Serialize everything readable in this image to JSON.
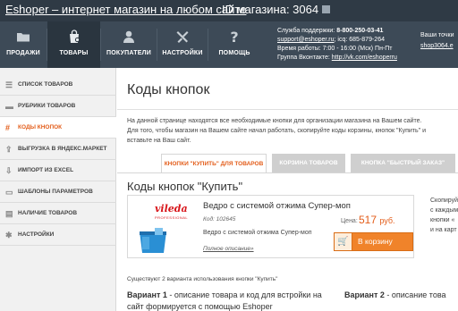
{
  "header": {
    "brand": "Eshoper – интернет магазин на любом сайте",
    "shop_id": "ID магазина: 3064"
  },
  "nav": {
    "items": [
      {
        "label": "ПРОДАЖИ",
        "icon": "folder-icon"
      },
      {
        "label": "ТОВАРЫ",
        "icon": "bag-gear-icon"
      },
      {
        "label": "ПОКУПАТЕЛИ",
        "icon": "user-icon"
      },
      {
        "label": "НАСТРОЙКИ",
        "icon": "tools-icon"
      },
      {
        "label": "ПОМОЩЬ",
        "icon": "question-icon"
      }
    ]
  },
  "support": {
    "line1_label": "Служба поддержки:",
    "line1_phone": "8-800-250-03-41",
    "line2_email": "support@eshoper.ru",
    "line2_icq": "; icq: 685-879-264",
    "line3": "Время работы: 7:00 - 16:00 (Мск) Пн-Пт",
    "line4_label": "Группа Вконтакте:",
    "line4_link": "http://vk.com/eshoperru"
  },
  "account": {
    "label": "Ваши точки",
    "shop": "shop3064.e"
  },
  "sidebar": {
    "items": [
      {
        "label": "СПИСОК ТОВАРОВ",
        "icon": "list-icon"
      },
      {
        "label": "РУБРИКИ ТОВАРОВ",
        "icon": "folder-icon"
      },
      {
        "label": "КОДЫ КНОПОК",
        "icon": "hash-icon"
      },
      {
        "label": "ВЫГРУЗКА В ЯНДЕКС.МАРКЕТ",
        "icon": "export-icon"
      },
      {
        "label": "ИМПОРТ ИЗ EXCEL",
        "icon": "import-icon"
      },
      {
        "label": "ШАБЛОНЫ ПАРАМЕТРОВ",
        "icon": "template-icon"
      },
      {
        "label": "НАЛИЧИЕ ТОВАРОВ",
        "icon": "stock-icon"
      },
      {
        "label": "НАСТРОЙКИ",
        "icon": "gear-icon"
      }
    ]
  },
  "main": {
    "title": "Коды кнопок",
    "intro_line1": "На данной странице находятся все необходимые кнопки для организации магазина на Вашем сайте.",
    "intro_line2": "Для того, чтобы магазин на Вашем сайте начал работать, скопируйте коды корзины, кнопок \"Купить\" и",
    "intro_line3": "вставьте на Ваш сайт.",
    "tabs": [
      {
        "label": "КНОПКИ \"КУПИТЬ\" ДЛЯ ТОВАРОВ"
      },
      {
        "label": "КОРЗИНА ТОВАРОВ"
      },
      {
        "label": "КНОПКА \"БЫСТРЫЙ ЗАКАЗ\""
      }
    ],
    "section_title": "Коды кнопок \"Купить\"",
    "product": {
      "brand": "vileda",
      "brand_sub": "PROFESSIONAL",
      "title": "Ведро с системой отжима Супер-моп",
      "code": "Код: 102645",
      "description": "Ведро с системой отжима Супер-моп",
      "more_link": "Полное описание»",
      "price_label": "Цена:",
      "price": "517",
      "currency": "руб.",
      "buy_label": "В корзину"
    },
    "right_note": [
      "Скопируй",
      "с каждым",
      "кнопки «",
      "и на карт"
    ],
    "variants_intro": "Существуют 2 варианта использования кнопки \"Купить\"",
    "variant1_title": "Вариант 1",
    "variant1_text": " - описание товара и код для встройки на",
    "variant1_text2": "сайт формируется с помощью Eshoper",
    "variant2_title": "Вариант 2",
    "variant2_text": " - описание това"
  },
  "colors": {
    "accent": "#e35d1a",
    "topbar": "#2f3a45",
    "navbar": "#3d4a57",
    "buy_button": "#f0832a"
  }
}
